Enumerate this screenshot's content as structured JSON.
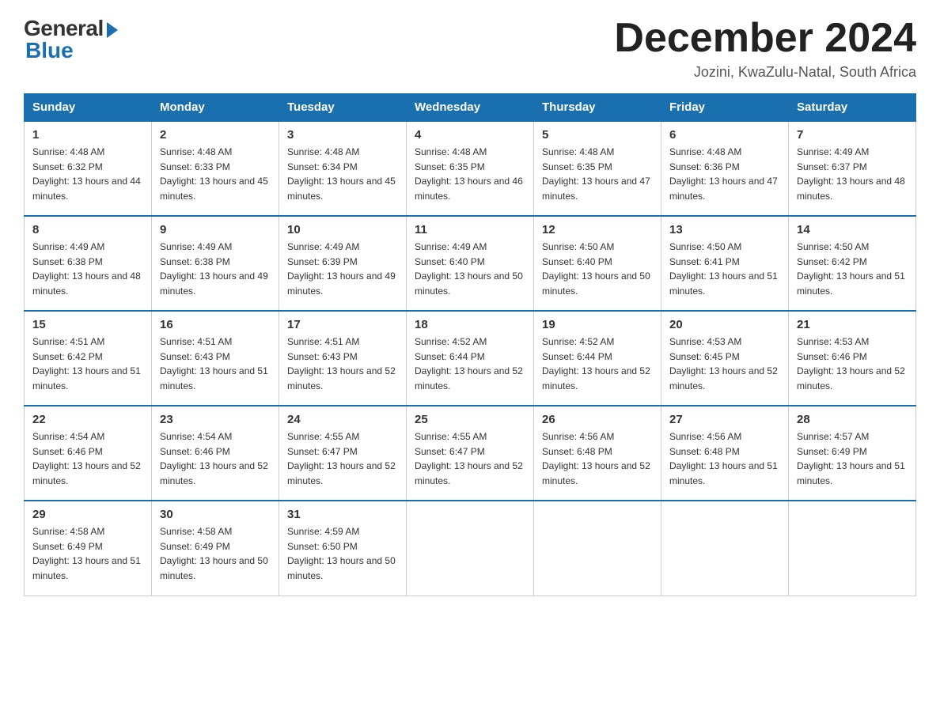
{
  "header": {
    "logo_general": "General",
    "logo_blue": "Blue",
    "month_title": "December 2024",
    "location": "Jozini, KwaZulu-Natal, South Africa"
  },
  "days_of_week": [
    "Sunday",
    "Monday",
    "Tuesday",
    "Wednesday",
    "Thursday",
    "Friday",
    "Saturday"
  ],
  "weeks": [
    [
      {
        "num": "1",
        "sunrise": "Sunrise: 4:48 AM",
        "sunset": "Sunset: 6:32 PM",
        "daylight": "Daylight: 13 hours and 44 minutes."
      },
      {
        "num": "2",
        "sunrise": "Sunrise: 4:48 AM",
        "sunset": "Sunset: 6:33 PM",
        "daylight": "Daylight: 13 hours and 45 minutes."
      },
      {
        "num": "3",
        "sunrise": "Sunrise: 4:48 AM",
        "sunset": "Sunset: 6:34 PM",
        "daylight": "Daylight: 13 hours and 45 minutes."
      },
      {
        "num": "4",
        "sunrise": "Sunrise: 4:48 AM",
        "sunset": "Sunset: 6:35 PM",
        "daylight": "Daylight: 13 hours and 46 minutes."
      },
      {
        "num": "5",
        "sunrise": "Sunrise: 4:48 AM",
        "sunset": "Sunset: 6:35 PM",
        "daylight": "Daylight: 13 hours and 47 minutes."
      },
      {
        "num": "6",
        "sunrise": "Sunrise: 4:48 AM",
        "sunset": "Sunset: 6:36 PM",
        "daylight": "Daylight: 13 hours and 47 minutes."
      },
      {
        "num": "7",
        "sunrise": "Sunrise: 4:49 AM",
        "sunset": "Sunset: 6:37 PM",
        "daylight": "Daylight: 13 hours and 48 minutes."
      }
    ],
    [
      {
        "num": "8",
        "sunrise": "Sunrise: 4:49 AM",
        "sunset": "Sunset: 6:38 PM",
        "daylight": "Daylight: 13 hours and 48 minutes."
      },
      {
        "num": "9",
        "sunrise": "Sunrise: 4:49 AM",
        "sunset": "Sunset: 6:38 PM",
        "daylight": "Daylight: 13 hours and 49 minutes."
      },
      {
        "num": "10",
        "sunrise": "Sunrise: 4:49 AM",
        "sunset": "Sunset: 6:39 PM",
        "daylight": "Daylight: 13 hours and 49 minutes."
      },
      {
        "num": "11",
        "sunrise": "Sunrise: 4:49 AM",
        "sunset": "Sunset: 6:40 PM",
        "daylight": "Daylight: 13 hours and 50 minutes."
      },
      {
        "num": "12",
        "sunrise": "Sunrise: 4:50 AM",
        "sunset": "Sunset: 6:40 PM",
        "daylight": "Daylight: 13 hours and 50 minutes."
      },
      {
        "num": "13",
        "sunrise": "Sunrise: 4:50 AM",
        "sunset": "Sunset: 6:41 PM",
        "daylight": "Daylight: 13 hours and 51 minutes."
      },
      {
        "num": "14",
        "sunrise": "Sunrise: 4:50 AM",
        "sunset": "Sunset: 6:42 PM",
        "daylight": "Daylight: 13 hours and 51 minutes."
      }
    ],
    [
      {
        "num": "15",
        "sunrise": "Sunrise: 4:51 AM",
        "sunset": "Sunset: 6:42 PM",
        "daylight": "Daylight: 13 hours and 51 minutes."
      },
      {
        "num": "16",
        "sunrise": "Sunrise: 4:51 AM",
        "sunset": "Sunset: 6:43 PM",
        "daylight": "Daylight: 13 hours and 51 minutes."
      },
      {
        "num": "17",
        "sunrise": "Sunrise: 4:51 AM",
        "sunset": "Sunset: 6:43 PM",
        "daylight": "Daylight: 13 hours and 52 minutes."
      },
      {
        "num": "18",
        "sunrise": "Sunrise: 4:52 AM",
        "sunset": "Sunset: 6:44 PM",
        "daylight": "Daylight: 13 hours and 52 minutes."
      },
      {
        "num": "19",
        "sunrise": "Sunrise: 4:52 AM",
        "sunset": "Sunset: 6:44 PM",
        "daylight": "Daylight: 13 hours and 52 minutes."
      },
      {
        "num": "20",
        "sunrise": "Sunrise: 4:53 AM",
        "sunset": "Sunset: 6:45 PM",
        "daylight": "Daylight: 13 hours and 52 minutes."
      },
      {
        "num": "21",
        "sunrise": "Sunrise: 4:53 AM",
        "sunset": "Sunset: 6:46 PM",
        "daylight": "Daylight: 13 hours and 52 minutes."
      }
    ],
    [
      {
        "num": "22",
        "sunrise": "Sunrise: 4:54 AM",
        "sunset": "Sunset: 6:46 PM",
        "daylight": "Daylight: 13 hours and 52 minutes."
      },
      {
        "num": "23",
        "sunrise": "Sunrise: 4:54 AM",
        "sunset": "Sunset: 6:46 PM",
        "daylight": "Daylight: 13 hours and 52 minutes."
      },
      {
        "num": "24",
        "sunrise": "Sunrise: 4:55 AM",
        "sunset": "Sunset: 6:47 PM",
        "daylight": "Daylight: 13 hours and 52 minutes."
      },
      {
        "num": "25",
        "sunrise": "Sunrise: 4:55 AM",
        "sunset": "Sunset: 6:47 PM",
        "daylight": "Daylight: 13 hours and 52 minutes."
      },
      {
        "num": "26",
        "sunrise": "Sunrise: 4:56 AM",
        "sunset": "Sunset: 6:48 PM",
        "daylight": "Daylight: 13 hours and 52 minutes."
      },
      {
        "num": "27",
        "sunrise": "Sunrise: 4:56 AM",
        "sunset": "Sunset: 6:48 PM",
        "daylight": "Daylight: 13 hours and 51 minutes."
      },
      {
        "num": "28",
        "sunrise": "Sunrise: 4:57 AM",
        "sunset": "Sunset: 6:49 PM",
        "daylight": "Daylight: 13 hours and 51 minutes."
      }
    ],
    [
      {
        "num": "29",
        "sunrise": "Sunrise: 4:58 AM",
        "sunset": "Sunset: 6:49 PM",
        "daylight": "Daylight: 13 hours and 51 minutes."
      },
      {
        "num": "30",
        "sunrise": "Sunrise: 4:58 AM",
        "sunset": "Sunset: 6:49 PM",
        "daylight": "Daylight: 13 hours and 50 minutes."
      },
      {
        "num": "31",
        "sunrise": "Sunrise: 4:59 AM",
        "sunset": "Sunset: 6:50 PM",
        "daylight": "Daylight: 13 hours and 50 minutes."
      },
      null,
      null,
      null,
      null
    ]
  ]
}
